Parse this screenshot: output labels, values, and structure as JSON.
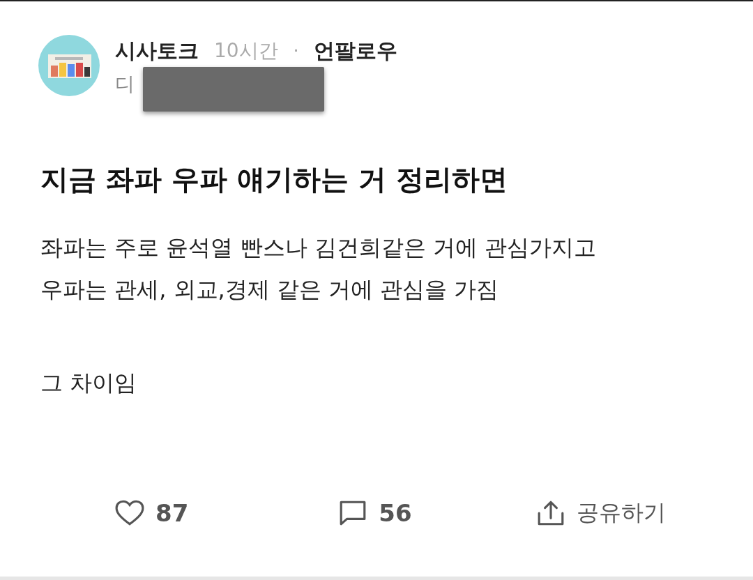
{
  "post": {
    "author": "시사토크",
    "time": "10시간",
    "separator": "·",
    "follow_label": "언팔로우",
    "subtitle": "디",
    "redacted": true,
    "avatar": {
      "kind": "picture"
    },
    "title": "지금 좌파 우파 얘기하는 거 정리하면",
    "paragraphs": [
      [
        "좌파는 주로 윤석열 빤스나 김건희같은 거에 관심가지고",
        "우파는 관세, 외교,경제 같은 거에 관심을 가짐"
      ],
      [
        "그 차이임"
      ]
    ]
  },
  "actions": [
    {
      "kind": "like",
      "count": "87"
    },
    {
      "kind": "comment",
      "count": "56"
    },
    {
      "kind": "share",
      "label": "공유하기"
    }
  ]
}
